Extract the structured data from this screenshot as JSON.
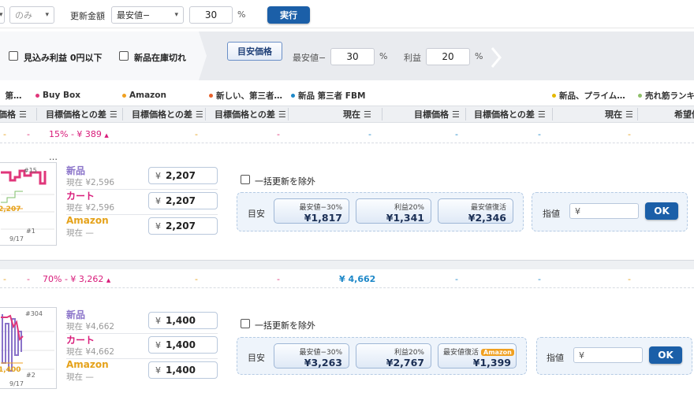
{
  "toolbar": {
    "only_select": "のみ",
    "update_amount_label": "更新金額",
    "update_amount_select": "最安値−",
    "update_amount_value": "30",
    "percent": "%",
    "run_button": "実行"
  },
  "filters": {
    "profit_zero_label": "見込み利益 0円以下",
    "new_out_of_stock_label": "新品在庫切れ",
    "goal_price_button": "目安価格",
    "lowest_label": "最安値−",
    "lowest_value": "30",
    "percent1": "%",
    "profit_label": "利益",
    "profit_value": "20",
    "percent2": "%"
  },
  "legend": [
    {
      "label": "、第…",
      "color": ""
    },
    {
      "label": "Buy Box",
      "color": "#e0367a"
    },
    {
      "label": "Amazon",
      "color": "#f0a020"
    },
    {
      "label": "新しい、第三者…",
      "color": "#e8612c"
    },
    {
      "label": "新品 第三者 FBM",
      "color": "#1e88c8"
    },
    {
      "label": "新品、プライム…",
      "color": "#e5b800"
    },
    {
      "label": "売れ筋ランキ…",
      "color": "#8fbf6a"
    }
  ],
  "columns": [
    "価格",
    "目標価格との差",
    "目標価格との差",
    "目標価格との差",
    "現在",
    "目標価格",
    "目標価格との差",
    "現在",
    "希望価"
  ],
  "menu_glyph": "☰",
  "products": [
    {
      "summary": {
        "dash_a": "-",
        "dash_b": "-",
        "pct_price": "15%  -  ¥ 389",
        "dash_c": "-",
        "dash_d": "-",
        "dash_e": "-",
        "dash_f": "-",
        "dash_g": "-",
        "dash_h": "-"
      },
      "title_ellipsis": "…",
      "chart": {
        "rank_top": "#15",
        "rank_bottom": "#1",
        "date": "9/17",
        "price_tag": "2,207"
      },
      "new": {
        "label": "新品",
        "current": "現在 ¥2,596",
        "price": "2,207"
      },
      "cart": {
        "label": "カート",
        "current": "現在 ¥2,596",
        "price": "2,207"
      },
      "amazon": {
        "label": "Amazon",
        "current": "現在 —",
        "price": "2,207"
      },
      "yen": "¥",
      "exclude_label": "一括更新を除外",
      "goal_label": "目安",
      "goals": [
        {
          "title": "最安値−30%",
          "value": "¥1,817",
          "badge": ""
        },
        {
          "title": "利益20%",
          "value": "¥1,341",
          "badge": ""
        },
        {
          "title": "最安値復活",
          "value": "¥2,346",
          "badge": ""
        }
      ],
      "limit_label": "指値",
      "limit_placeholder": "¥",
      "ok": "OK"
    },
    {
      "summary": {
        "dash_a": "-",
        "dash_b": "-",
        "pct_price": "70%  -  ¥ 3,262",
        "dash_c": "-",
        "dash_d": "-",
        "current": "¥ 4,662",
        "dash_e": "-",
        "dash_f": "-",
        "dash_g": "-",
        "dash_h": "-"
      },
      "chart": {
        "rank_top": "#304",
        "rank_bottom": "#2",
        "date": "9/17",
        "price_tag": "1,400"
      },
      "new": {
        "label": "新品",
        "current": "現在 ¥4,662",
        "price": "1,400"
      },
      "cart": {
        "label": "カート",
        "current": "現在 ¥4,662",
        "price": "1,400"
      },
      "amazon": {
        "label": "Amazon",
        "current": "現在 —",
        "price": "1,400"
      },
      "yen": "¥",
      "exclude_label": "一括更新を除外",
      "goal_label": "目安",
      "goals": [
        {
          "title": "最安値−30%",
          "value": "¥3,263",
          "badge": ""
        },
        {
          "title": "利益20%",
          "value": "¥2,767",
          "badge": ""
        },
        {
          "title": "最安値復活",
          "value": "¥1,399",
          "badge": "Amazon"
        }
      ],
      "limit_label": "指値",
      "limit_placeholder": "¥",
      "ok": "OK"
    }
  ]
}
